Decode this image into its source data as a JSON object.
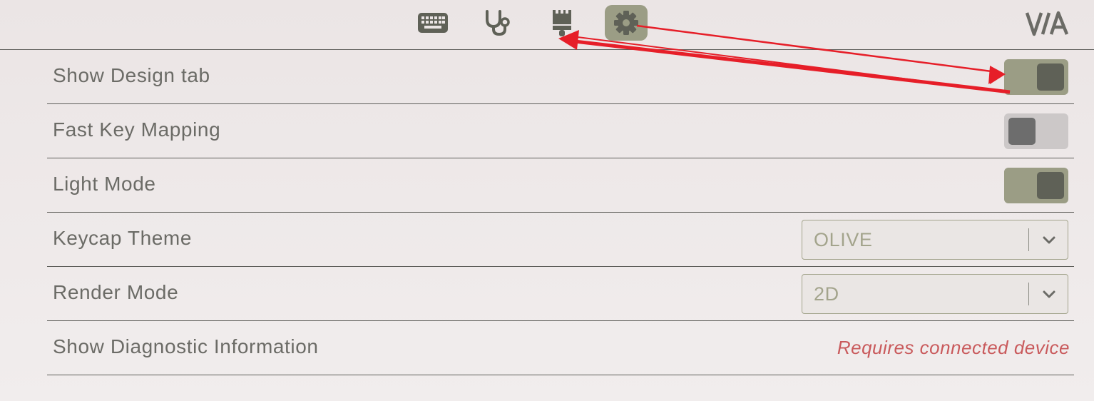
{
  "header": {
    "tabs": [
      {
        "icon": "keyboard-icon",
        "name": "Configure",
        "active": false
      },
      {
        "icon": "stethoscope-icon",
        "name": "Test",
        "active": false
      },
      {
        "icon": "paintbrush-icon",
        "name": "Design",
        "active": false
      },
      {
        "icon": "gear-icon",
        "name": "Settings",
        "active": true
      }
    ],
    "logo_text": "VIA"
  },
  "settings": [
    {
      "label": "Show Design tab",
      "control": "toggle",
      "enabled": true
    },
    {
      "label": "Fast Key Mapping",
      "control": "toggle",
      "enabled": false
    },
    {
      "label": "Light Mode",
      "control": "toggle",
      "enabled": true
    },
    {
      "label": "Keycap Theme",
      "control": "select",
      "value": "OLIVE"
    },
    {
      "label": "Render Mode",
      "control": "select",
      "value": "2D"
    },
    {
      "label": "Show Diagnostic Information",
      "control": "note",
      "note": "Requires connected device"
    }
  ],
  "colors": {
    "accent": "#9b9d85",
    "knob_on": "#5f6157",
    "toggle_off": "#ccc8c8",
    "knob_off": "#6d6d6d",
    "icon": "#5f6157",
    "warning_text": "#c95a5c",
    "annotation_arrow": "#e61e28"
  }
}
